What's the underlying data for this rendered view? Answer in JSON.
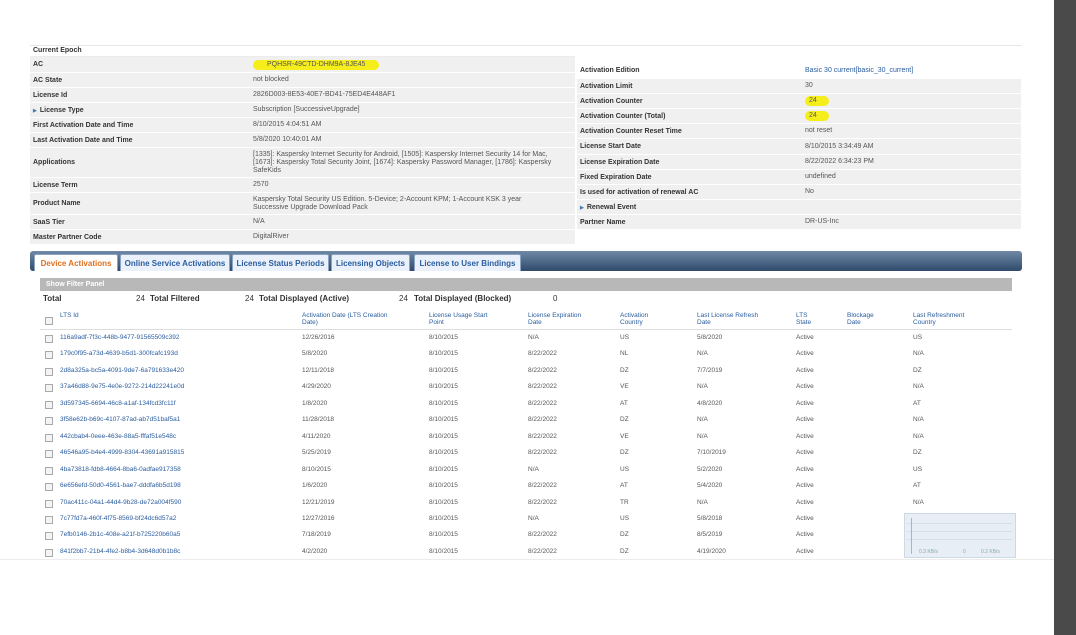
{
  "left_fields": [
    {
      "label": "Current Epoch",
      "value": ""
    },
    {
      "label": "AC",
      "value": "PQHSR-49CTD-DHM9A-8JE45",
      "highlight": true
    },
    {
      "label": "AC State",
      "value": "not blocked"
    },
    {
      "label": "License Id",
      "value": "2826D003-8E53-40E7-BD41-75ED4E448AF1"
    },
    {
      "label": "License Type",
      "value": "Subscription [SuccessiveUpgrade]",
      "expandable": true
    },
    {
      "label": "First Activation Date and Time",
      "value": "8/10/2015 4:04:51 AM"
    },
    {
      "label": "Last Activation Date and Time",
      "value": "5/8/2020 10:40:01 AM"
    },
    {
      "label": "Applications",
      "value": "[1335]: Kaspersky Internet Security for Android, [1505]: Kaspersky Internet Security 14 for Mac, [1673]: Kaspersky Total Security Joint, [1674]: Kaspersky Password Manager, [1786]: Kaspersky SafeKids"
    },
    {
      "label": "License Term",
      "value": "2570"
    },
    {
      "label": "Product Name",
      "value": "Kaspersky Total Security US Edition. 5-Device; 2-Account KPM; 1-Account KSK 3 year Successive Upgrade Download Pack"
    },
    {
      "label": "SaaS Tier",
      "value": "N/A"
    },
    {
      "label": "Master Partner Code",
      "value": "DigitalRiver"
    }
  ],
  "right_fields": [
    {
      "label": "Activation Edition",
      "value": "Basic 30 current[basic_30_current]",
      "link": true
    },
    {
      "label": "Activation Limit",
      "value": "30"
    },
    {
      "label": "Activation Counter",
      "value": "24",
      "highlight": true
    },
    {
      "label": "Activation Counter (Total)",
      "value": "24",
      "highlight": true
    },
    {
      "label": "Activation Counter Reset Time",
      "value": "not reset"
    },
    {
      "label": "License Start Date",
      "value": "8/10/2015 3:34:49 AM"
    },
    {
      "label": "License Expiration Date",
      "value": "8/22/2022 6:34:23 PM"
    },
    {
      "label": "Fixed Expiration Date",
      "value": "undefined"
    },
    {
      "label": "Is used for activation of renewal AC",
      "value": "No"
    },
    {
      "label": "Renewal Event",
      "value": "",
      "expandable": true
    },
    {
      "label": "Partner Name",
      "value": "DR-US-Inc"
    }
  ],
  "tabs": [
    {
      "label": "Device Activations",
      "active": true
    },
    {
      "label": "Online Service Activations"
    },
    {
      "label": "License Status Periods"
    },
    {
      "label": "Licensing Objects"
    },
    {
      "label": "License to User Bindings"
    }
  ],
  "filter_panel_label": "Show Filter Panel",
  "totals": {
    "total_label": "Total",
    "total": "24",
    "filtered_label": "Total Filtered",
    "filtered": "24",
    "active_label": "Total Displayed (Active)",
    "active": "24",
    "blocked_label": "Total Displayed (Blocked)",
    "blocked": "0"
  },
  "columns": {
    "lts_id": "LTS Id",
    "activation_date": "Activation Date (LTS Creation Date)",
    "usage_start": "License Usage Start Point",
    "expiration": "License Expiration Date",
    "country": "Activation Country",
    "last_refresh": "Last License Refresh Date",
    "lts_state": "LTS State",
    "blockage": "Blockage Date",
    "refresh_country": "Last Refreshment Country"
  },
  "rows": [
    {
      "id": "116a9adf-7f3c-448b-9477-91565509c392",
      "act": "12/26/2016",
      "start": "8/10/2015",
      "exp": "N/A",
      "country": "US",
      "refresh": "5/8/2020",
      "state": "Active",
      "rc": "US"
    },
    {
      "id": "179c0f95-a73d-4639-b5d1-300fcafc193d",
      "act": "5/8/2020",
      "start": "8/10/2015",
      "exp": "8/22/2022",
      "country": "NL",
      "refresh": "N/A",
      "state": "Active",
      "rc": "N/A"
    },
    {
      "id": "2d8a325a-bc5a-4091-9de7-6a791633e420",
      "act": "12/11/2018",
      "start": "8/10/2015",
      "exp": "8/22/2022",
      "country": "DZ",
      "refresh": "7/7/2019",
      "state": "Active",
      "rc": "DZ"
    },
    {
      "id": "37a46d88-9e75-4e0e-9272-214d22241e0d",
      "act": "4/29/2020",
      "start": "8/10/2015",
      "exp": "8/22/2022",
      "country": "VE",
      "refresh": "N/A",
      "state": "Active",
      "rc": "N/A"
    },
    {
      "id": "3d597345-6694-46c8-a1af-134fcd3fc11f",
      "act": "1/8/2020",
      "start": "8/10/2015",
      "exp": "8/22/2022",
      "country": "AT",
      "refresh": "4/8/2020",
      "state": "Active",
      "rc": "AT"
    },
    {
      "id": "3f58e62b-b69c-4107-87ad-ab7d51baf5a1",
      "act": "11/28/2018",
      "start": "8/10/2015",
      "exp": "8/22/2022",
      "country": "DZ",
      "refresh": "N/A",
      "state": "Active",
      "rc": "N/A"
    },
    {
      "id": "442cbab4-0eee-463e-88a5-fffaf51e548c",
      "act": "4/11/2020",
      "start": "8/10/2015",
      "exp": "8/22/2022",
      "country": "VE",
      "refresh": "N/A",
      "state": "Active",
      "rc": "N/A"
    },
    {
      "id": "46546a95-b4e4-4999-8304-43691a915815",
      "act": "5/25/2019",
      "start": "8/10/2015",
      "exp": "8/22/2022",
      "country": "DZ",
      "refresh": "7/10/2019",
      "state": "Active",
      "rc": "DZ"
    },
    {
      "id": "4ba73818-fdb8-4664-8ba6-0adfae917358",
      "act": "8/10/2015",
      "start": "8/10/2015",
      "exp": "N/A",
      "country": "US",
      "refresh": "5/2/2020",
      "state": "Active",
      "rc": "US"
    },
    {
      "id": "6e656efd-50d0-4561-bae7-dddfa6b5d198",
      "act": "1/6/2020",
      "start": "8/10/2015",
      "exp": "8/22/2022",
      "country": "AT",
      "refresh": "5/4/2020",
      "state": "Active",
      "rc": "AT"
    },
    {
      "id": "70ac411c-04a1-44d4-9b28-de72a004f590",
      "act": "12/21/2019",
      "start": "8/10/2015",
      "exp": "8/22/2022",
      "country": "TR",
      "refresh": "N/A",
      "state": "Active",
      "rc": "N/A"
    },
    {
      "id": "7c77fd7a-460f-4f75-8569-bf24dc6d57a2",
      "act": "12/27/2016",
      "start": "8/10/2015",
      "exp": "N/A",
      "country": "US",
      "refresh": "5/8/2018",
      "state": "Active",
      "rc": "US"
    },
    {
      "id": "7efb0146-2b1c-408e-a21f-b725220b60a5",
      "act": "7/18/2019",
      "start": "8/10/2015",
      "exp": "8/22/2022",
      "country": "DZ",
      "refresh": "8/5/2019",
      "state": "Active",
      "rc": "DZ"
    },
    {
      "id": "841f2bb7-21b4-4fe2-b8b4-3d648d0b1b8c",
      "act": "4/2/2020",
      "start": "8/10/2015",
      "exp": "8/22/2022",
      "country": "DZ",
      "refresh": "4/19/2020",
      "state": "Active",
      "rc": "DZ"
    }
  ],
  "mini_chart": {
    "label_a": "0.3 KB/s",
    "label_b": "0",
    "label_c": "0.2 KB/s"
  }
}
